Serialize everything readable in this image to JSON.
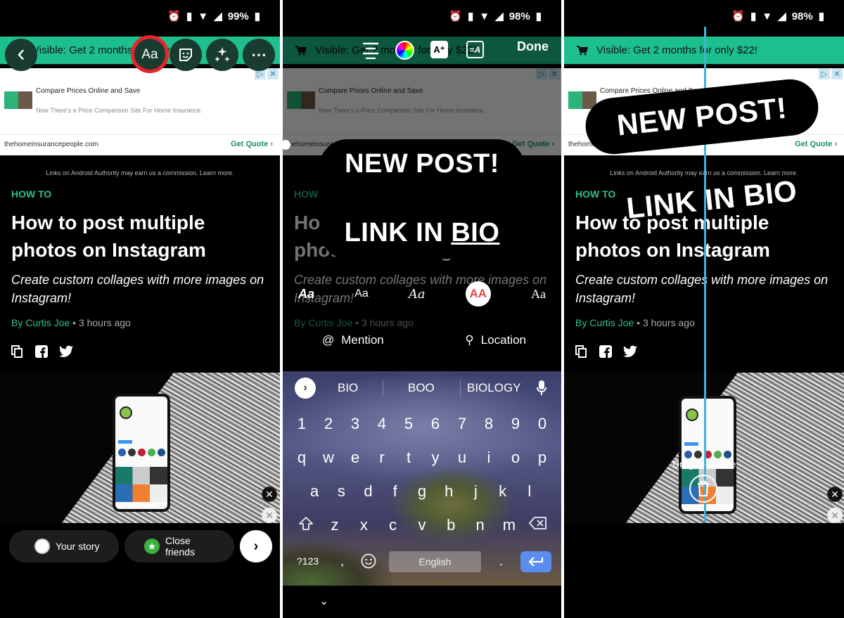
{
  "shared": {
    "promo_text": "Visible: Get 2 months for only $22!",
    "ad": {
      "title": "Compare Prices Online and Save",
      "body": "Now There's a Price Comparison Site For Home Insurance.",
      "domain": "thehomeinsurancepeople.com",
      "cta": "Get Quote",
      "cta_chevron": "›",
      "adchoices": "▷",
      "close": "✕"
    },
    "disclaimer": "Links on Android Authority may earn us a commission. Learn more.",
    "article": {
      "category": "HOW TO",
      "title": "How to post multiple photos on Instagram",
      "subtitle": "Create custom collages with more images on Instagram!",
      "author": "By Curtis Joe",
      "separator": "•",
      "time": "3 hours ago"
    },
    "accent_green": "#1dbf8e",
    "highlight_red": "#e8232b"
  },
  "panel1": {
    "status": {
      "battery": "99%"
    },
    "toolbar": {
      "back": "‹",
      "text_tool": "Aa",
      "more": "⋯"
    },
    "share": {
      "your_story": "Your story",
      "close_friends": "Close friends",
      "next": "›"
    }
  },
  "panel2": {
    "status": {
      "battery": "98%"
    },
    "toolbar": {
      "done": "Done"
    },
    "sticker_text": {
      "line1": "NEW POST!",
      "line2_a": "LINK IN ",
      "line2_b": "BIO"
    },
    "fonts": [
      "Aa",
      "Aa",
      "Aa",
      "AA",
      "Aa"
    ],
    "selected_font_index": 3,
    "mention": "Mention",
    "location": "Location",
    "keyboard": {
      "suggestions": [
        "BIO",
        "BOO",
        "BIOLOGY"
      ],
      "numbers": [
        "1",
        "2",
        "3",
        "4",
        "5",
        "6",
        "7",
        "8",
        "9",
        "0"
      ],
      "row1": [
        "q",
        "w",
        "e",
        "r",
        "t",
        "y",
        "u",
        "i",
        "o",
        "p"
      ],
      "row2": [
        "a",
        "s",
        "d",
        "f",
        "g",
        "h",
        "j",
        "k",
        "l"
      ],
      "row3": [
        "z",
        "x",
        "c",
        "v",
        "b",
        "n",
        "m"
      ],
      "symbols": "?123",
      "comma": ",",
      "space": "English",
      "period": ".",
      "hide": "⌄"
    }
  },
  "panel3": {
    "status": {
      "battery": "98%"
    },
    "sticker_text": {
      "line1": "NEW POST!",
      "line2": "LINK IN BIO"
    },
    "drag_to_delete": "Drag to Delete",
    "guide_color": "#3fb4d6"
  }
}
